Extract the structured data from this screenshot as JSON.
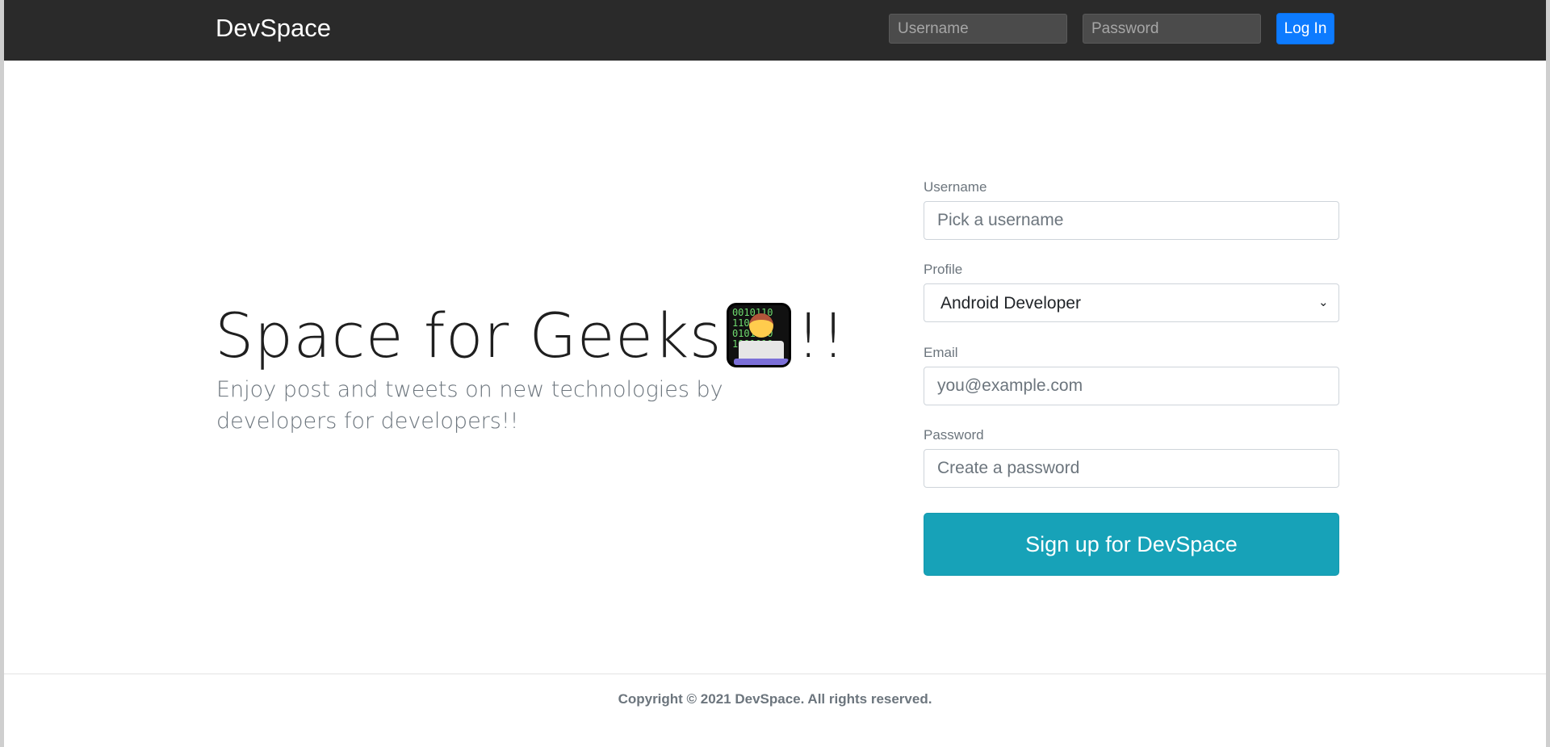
{
  "navbar": {
    "brand": "DevSpace",
    "username_placeholder": "Username",
    "password_placeholder": "Password",
    "login_label": "Log In",
    "background_color": "#2a2a2a",
    "login_color": "#0d7bff"
  },
  "hero": {
    "title": "Space for Geeks",
    "title_suffix": "!!",
    "emoji_icon": "technologist-emoji-icon",
    "emoji_bits": "0010110\n1100101\n0101000\n1001010",
    "subtitle": "Enjoy post and tweets on new technologies by developers for developers!!"
  },
  "signup_form": {
    "username_label": "Username",
    "username_placeholder": "Pick a username",
    "profile_label": "Profile",
    "profile_selected": "Android Developer",
    "email_label": "Email",
    "email_placeholder": "you@example.com",
    "password_label": "Password",
    "password_placeholder": "Create a password",
    "submit_label": "Sign up for DevSpace",
    "submit_color": "#17a2b8"
  },
  "footer": {
    "copyright": "Copyright © 2021 DevSpace. All rights reserved."
  }
}
